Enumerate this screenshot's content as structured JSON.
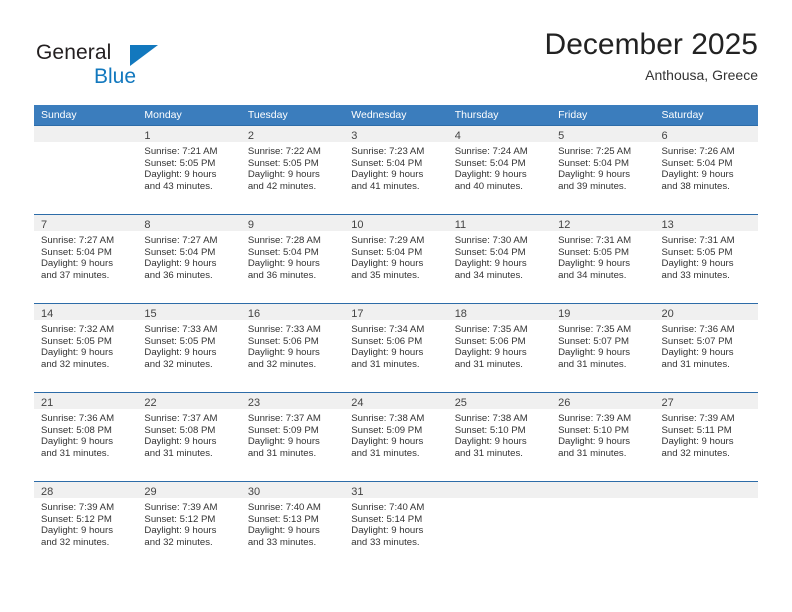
{
  "brand": {
    "name_top": "General",
    "name_bottom": "Blue",
    "accent_color": "#1278be"
  },
  "header": {
    "title": "December 2025",
    "location": "Anthousa, Greece"
  },
  "calendar": {
    "header_bg": "#3b7dbd",
    "row_divider": "#2d6ca8",
    "daynum_bg": "#f0f0f0",
    "weekdays": [
      "Sunday",
      "Monday",
      "Tuesday",
      "Wednesday",
      "Thursday",
      "Friday",
      "Saturday"
    ],
    "weeks": [
      [
        {
          "day": "",
          "sunrise": "",
          "sunset": "",
          "daylight_1": "",
          "daylight_2": ""
        },
        {
          "day": "1",
          "sunrise": "Sunrise: 7:21 AM",
          "sunset": "Sunset: 5:05 PM",
          "daylight_1": "Daylight: 9 hours",
          "daylight_2": "and 43 minutes."
        },
        {
          "day": "2",
          "sunrise": "Sunrise: 7:22 AM",
          "sunset": "Sunset: 5:05 PM",
          "daylight_1": "Daylight: 9 hours",
          "daylight_2": "and 42 minutes."
        },
        {
          "day": "3",
          "sunrise": "Sunrise: 7:23 AM",
          "sunset": "Sunset: 5:04 PM",
          "daylight_1": "Daylight: 9 hours",
          "daylight_2": "and 41 minutes."
        },
        {
          "day": "4",
          "sunrise": "Sunrise: 7:24 AM",
          "sunset": "Sunset: 5:04 PM",
          "daylight_1": "Daylight: 9 hours",
          "daylight_2": "and 40 minutes."
        },
        {
          "day": "5",
          "sunrise": "Sunrise: 7:25 AM",
          "sunset": "Sunset: 5:04 PM",
          "daylight_1": "Daylight: 9 hours",
          "daylight_2": "and 39 minutes."
        },
        {
          "day": "6",
          "sunrise": "Sunrise: 7:26 AM",
          "sunset": "Sunset: 5:04 PM",
          "daylight_1": "Daylight: 9 hours",
          "daylight_2": "and 38 minutes."
        }
      ],
      [
        {
          "day": "7",
          "sunrise": "Sunrise: 7:27 AM",
          "sunset": "Sunset: 5:04 PM",
          "daylight_1": "Daylight: 9 hours",
          "daylight_2": "and 37 minutes."
        },
        {
          "day": "8",
          "sunrise": "Sunrise: 7:27 AM",
          "sunset": "Sunset: 5:04 PM",
          "daylight_1": "Daylight: 9 hours",
          "daylight_2": "and 36 minutes."
        },
        {
          "day": "9",
          "sunrise": "Sunrise: 7:28 AM",
          "sunset": "Sunset: 5:04 PM",
          "daylight_1": "Daylight: 9 hours",
          "daylight_2": "and 36 minutes."
        },
        {
          "day": "10",
          "sunrise": "Sunrise: 7:29 AM",
          "sunset": "Sunset: 5:04 PM",
          "daylight_1": "Daylight: 9 hours",
          "daylight_2": "and 35 minutes."
        },
        {
          "day": "11",
          "sunrise": "Sunrise: 7:30 AM",
          "sunset": "Sunset: 5:04 PM",
          "daylight_1": "Daylight: 9 hours",
          "daylight_2": "and 34 minutes."
        },
        {
          "day": "12",
          "sunrise": "Sunrise: 7:31 AM",
          "sunset": "Sunset: 5:05 PM",
          "daylight_1": "Daylight: 9 hours",
          "daylight_2": "and 34 minutes."
        },
        {
          "day": "13",
          "sunrise": "Sunrise: 7:31 AM",
          "sunset": "Sunset: 5:05 PM",
          "daylight_1": "Daylight: 9 hours",
          "daylight_2": "and 33 minutes."
        }
      ],
      [
        {
          "day": "14",
          "sunrise": "Sunrise: 7:32 AM",
          "sunset": "Sunset: 5:05 PM",
          "daylight_1": "Daylight: 9 hours",
          "daylight_2": "and 32 minutes."
        },
        {
          "day": "15",
          "sunrise": "Sunrise: 7:33 AM",
          "sunset": "Sunset: 5:05 PM",
          "daylight_1": "Daylight: 9 hours",
          "daylight_2": "and 32 minutes."
        },
        {
          "day": "16",
          "sunrise": "Sunrise: 7:33 AM",
          "sunset": "Sunset: 5:06 PM",
          "daylight_1": "Daylight: 9 hours",
          "daylight_2": "and 32 minutes."
        },
        {
          "day": "17",
          "sunrise": "Sunrise: 7:34 AM",
          "sunset": "Sunset: 5:06 PM",
          "daylight_1": "Daylight: 9 hours",
          "daylight_2": "and 31 minutes."
        },
        {
          "day": "18",
          "sunrise": "Sunrise: 7:35 AM",
          "sunset": "Sunset: 5:06 PM",
          "daylight_1": "Daylight: 9 hours",
          "daylight_2": "and 31 minutes."
        },
        {
          "day": "19",
          "sunrise": "Sunrise: 7:35 AM",
          "sunset": "Sunset: 5:07 PM",
          "daylight_1": "Daylight: 9 hours",
          "daylight_2": "and 31 minutes."
        },
        {
          "day": "20",
          "sunrise": "Sunrise: 7:36 AM",
          "sunset": "Sunset: 5:07 PM",
          "daylight_1": "Daylight: 9 hours",
          "daylight_2": "and 31 minutes."
        }
      ],
      [
        {
          "day": "21",
          "sunrise": "Sunrise: 7:36 AM",
          "sunset": "Sunset: 5:08 PM",
          "daylight_1": "Daylight: 9 hours",
          "daylight_2": "and 31 minutes."
        },
        {
          "day": "22",
          "sunrise": "Sunrise: 7:37 AM",
          "sunset": "Sunset: 5:08 PM",
          "daylight_1": "Daylight: 9 hours",
          "daylight_2": "and 31 minutes."
        },
        {
          "day": "23",
          "sunrise": "Sunrise: 7:37 AM",
          "sunset": "Sunset: 5:09 PM",
          "daylight_1": "Daylight: 9 hours",
          "daylight_2": "and 31 minutes."
        },
        {
          "day": "24",
          "sunrise": "Sunrise: 7:38 AM",
          "sunset": "Sunset: 5:09 PM",
          "daylight_1": "Daylight: 9 hours",
          "daylight_2": "and 31 minutes."
        },
        {
          "day": "25",
          "sunrise": "Sunrise: 7:38 AM",
          "sunset": "Sunset: 5:10 PM",
          "daylight_1": "Daylight: 9 hours",
          "daylight_2": "and 31 minutes."
        },
        {
          "day": "26",
          "sunrise": "Sunrise: 7:39 AM",
          "sunset": "Sunset: 5:10 PM",
          "daylight_1": "Daylight: 9 hours",
          "daylight_2": "and 31 minutes."
        },
        {
          "day": "27",
          "sunrise": "Sunrise: 7:39 AM",
          "sunset": "Sunset: 5:11 PM",
          "daylight_1": "Daylight: 9 hours",
          "daylight_2": "and 32 minutes."
        }
      ],
      [
        {
          "day": "28",
          "sunrise": "Sunrise: 7:39 AM",
          "sunset": "Sunset: 5:12 PM",
          "daylight_1": "Daylight: 9 hours",
          "daylight_2": "and 32 minutes."
        },
        {
          "day": "29",
          "sunrise": "Sunrise: 7:39 AM",
          "sunset": "Sunset: 5:12 PM",
          "daylight_1": "Daylight: 9 hours",
          "daylight_2": "and 32 minutes."
        },
        {
          "day": "30",
          "sunrise": "Sunrise: 7:40 AM",
          "sunset": "Sunset: 5:13 PM",
          "daylight_1": "Daylight: 9 hours",
          "daylight_2": "and 33 minutes."
        },
        {
          "day": "31",
          "sunrise": "Sunrise: 7:40 AM",
          "sunset": "Sunset: 5:14 PM",
          "daylight_1": "Daylight: 9 hours",
          "daylight_2": "and 33 minutes."
        },
        {
          "day": "",
          "sunrise": "",
          "sunset": "",
          "daylight_1": "",
          "daylight_2": ""
        },
        {
          "day": "",
          "sunrise": "",
          "sunset": "",
          "daylight_1": "",
          "daylight_2": ""
        },
        {
          "day": "",
          "sunrise": "",
          "sunset": "",
          "daylight_1": "",
          "daylight_2": ""
        }
      ]
    ]
  }
}
